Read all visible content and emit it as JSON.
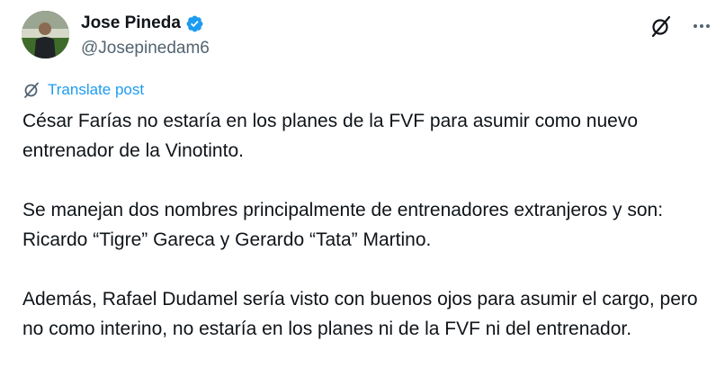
{
  "author": {
    "display_name": "Jose Pineda",
    "handle": "@Josepinedam6",
    "verified": true,
    "verified_color": "#1d9bf0"
  },
  "actions": {
    "grok_icon": "grok-icon",
    "more_icon": "more-icon"
  },
  "translate": {
    "label": "Translate post",
    "color": "#1d9bf0"
  },
  "post": {
    "paragraphs": [
      "César Farías no estaría en los planes de la FVF para asumir como nuevo entrenador de la Vinotinto.",
      "Se manejan dos nombres principalmente de entrenadores extranjeros y son: Ricardo “Tigre” Gareca y Gerardo “Tata” Martino.",
      "Además, Rafael Dudamel sería visto con buenos ojos para asumir el cargo, pero no como interino, no estaría en los planes ni de la FVF ni del entrenador."
    ]
  }
}
